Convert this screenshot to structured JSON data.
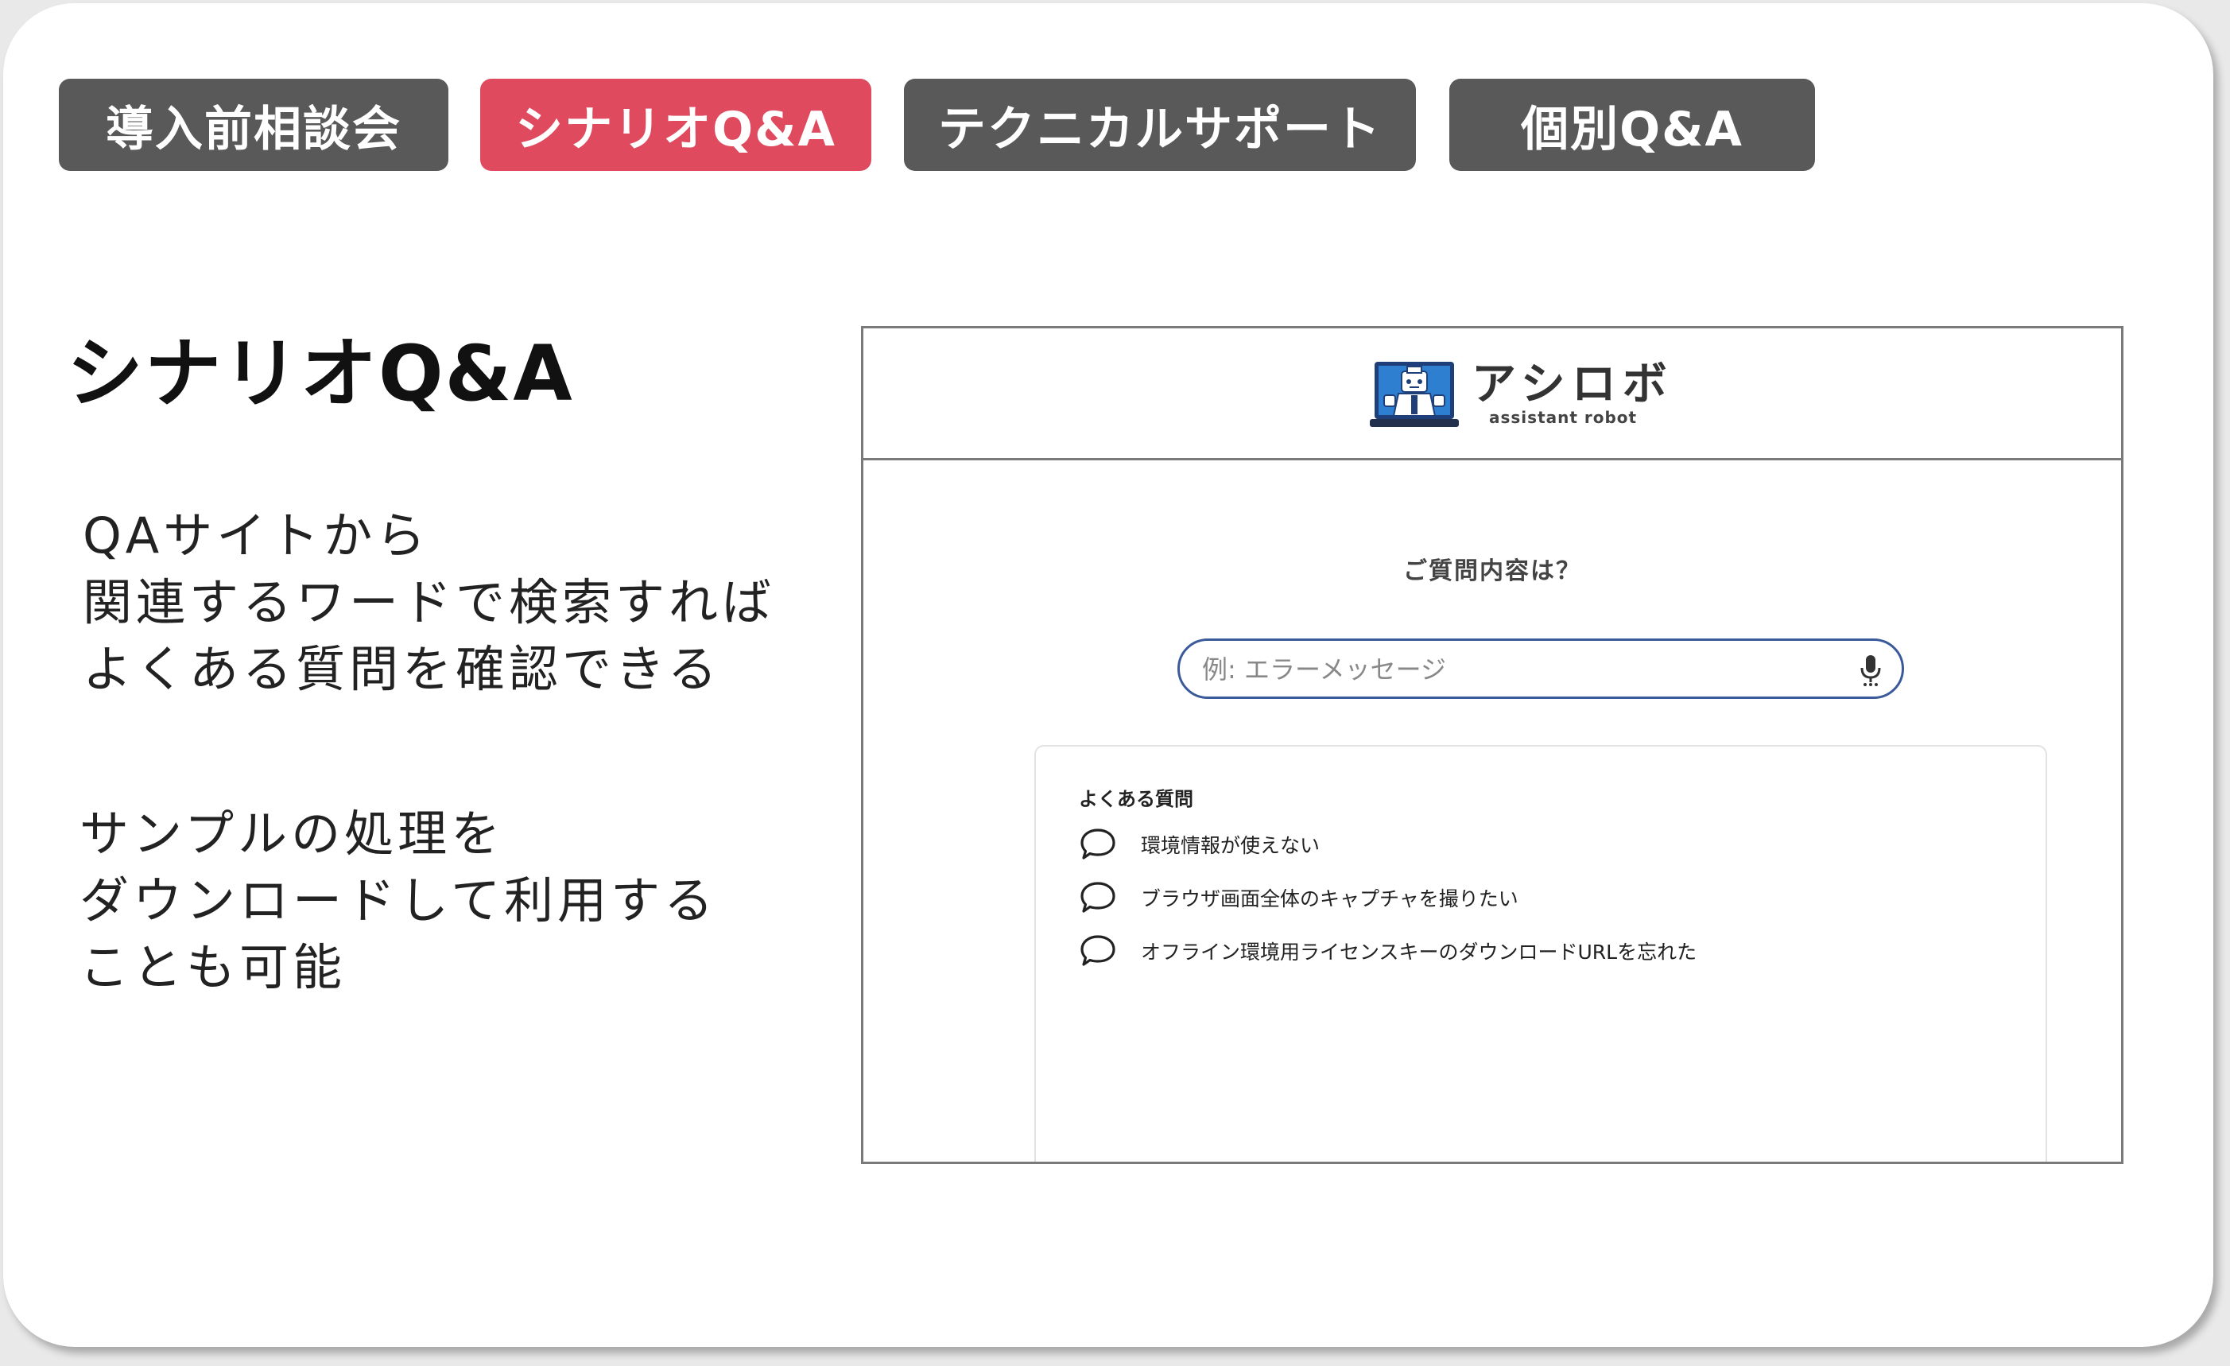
{
  "tabs": [
    {
      "label": "導入前相談会",
      "active": false
    },
    {
      "label": "シナリオQ&A",
      "active": true
    },
    {
      "label": "テクニカルサポート",
      "active": false
    },
    {
      "label": "個別Q&A",
      "active": false
    }
  ],
  "page_title": "シナリオQ&A",
  "description_1": [
    "QAサイトから",
    "関連するワードで検索すれば",
    "よくある質問を確認できる"
  ],
  "description_2": [
    "サンプルの処理を",
    "ダウンロードして利用する",
    "ことも可能"
  ],
  "screenshot": {
    "logo": {
      "name": "アシロボ",
      "tagline": "assistant robot"
    },
    "question_title": "ご質問内容は？",
    "search": {
      "placeholder": "例: エラーメッセージ",
      "value": ""
    },
    "faq": {
      "title": "よくある質問",
      "items": [
        "環境情報が使えない",
        "ブラウザ画面全体のキャプチャを撮りたい",
        "オフライン環境用ライセンスキーのダウンロードURLを忘れた"
      ]
    }
  },
  "icons": {
    "logo": "robot-laptop-logo-icon",
    "search_mic": "microphone-icon",
    "faq_item": "speech-bubble-icon"
  },
  "colors": {
    "tab_default": "#595959",
    "tab_active": "#e04a5f",
    "search_border": "#3b5a9a"
  }
}
